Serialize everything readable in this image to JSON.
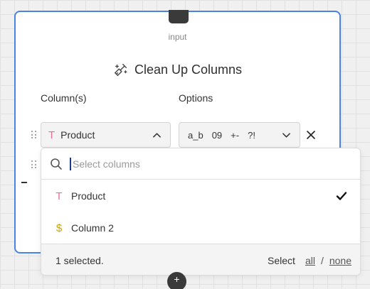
{
  "node": {
    "input_label": "input",
    "title": "Clean Up Columns",
    "title_icon": "broom-sparkle-icon"
  },
  "form": {
    "columns_label": "Column(s)",
    "options_label": "Options",
    "column_select_value": "Product",
    "column_select_type_icon": "T",
    "options": [
      "a_b",
      "09",
      "+-",
      "?!"
    ]
  },
  "dropdown": {
    "search_placeholder": "Select columns",
    "items": [
      {
        "type_icon": "T",
        "type_color": "#e0719a",
        "label": "Product",
        "selected": true
      },
      {
        "type_icon": "$",
        "type_color": "#c9a400",
        "label": "Column 2",
        "selected": false
      }
    ],
    "status": "1 selected.",
    "select_label": "Select",
    "all_label": "all",
    "slash": "/",
    "none_label": "none"
  },
  "port_bottom_glyph": "+",
  "colors": {
    "accent_border": "#4a82e5",
    "text_type_icon": "#e0719a",
    "number_type_icon": "#c9a400"
  }
}
